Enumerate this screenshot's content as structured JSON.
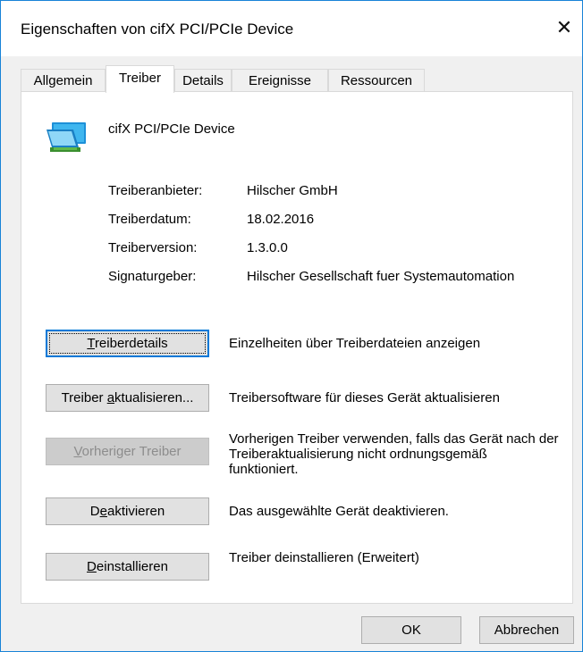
{
  "window": {
    "title": "Eigenschaften von cifX PCI/PCIe Device",
    "close_glyph": "✕"
  },
  "tabs": [
    {
      "label": "Allgemein",
      "active": false
    },
    {
      "label": "Treiber",
      "active": true
    },
    {
      "label": "Details",
      "active": false
    },
    {
      "label": "Ereignisse",
      "active": false
    },
    {
      "label": "Ressourcen",
      "active": false
    }
  ],
  "device": {
    "icon": "network-adapter-icon",
    "name": "cifX PCI/PCIe Device"
  },
  "info": [
    {
      "label": "Treiberanbieter:",
      "value": "Hilscher GmbH"
    },
    {
      "label": "Treiberdatum:",
      "value": "18.02.2016"
    },
    {
      "label": "Treiberversion:",
      "value": "1.3.0.0"
    },
    {
      "label": "Signaturgeber:",
      "value": "Hilscher Gesellschaft fuer Systemautomation"
    }
  ],
  "actions": [
    {
      "pre": "",
      "key": "T",
      "post": "reiberdetails",
      "description": "Einzelheiten über Treiberdateien anzeigen",
      "enabled": true,
      "focused": true
    },
    {
      "pre": "Treiber ",
      "key": "a",
      "post": "ktualisieren...",
      "description": "Treibersoftware für dieses Gerät aktualisieren",
      "enabled": true,
      "focused": false
    },
    {
      "pre": "",
      "key": "V",
      "post": "orheriger Treiber",
      "description": "Vorherigen Treiber verwenden, falls das Gerät nach der Treiberaktualisierung nicht ordnungsgemäß funktioniert.",
      "enabled": false,
      "focused": false
    },
    {
      "pre": "D",
      "key": "e",
      "post": "aktivieren",
      "description": "Das ausgewählte Gerät deaktivieren.",
      "enabled": true,
      "focused": false
    },
    {
      "pre": "",
      "key": "D",
      "post": "einstallieren",
      "description": "Treiber deinstallieren (Erweitert)",
      "enabled": true,
      "focused": false
    }
  ],
  "footer": {
    "ok_label": "OK",
    "cancel_label": "Abbrechen"
  },
  "colors": {
    "window_border": "#1883d7",
    "focus_blue": "#0078d7",
    "dialog_bg": "#f0f0f0",
    "button_bg": "#e1e1e1",
    "disabled_text": "#8d8d8d"
  }
}
